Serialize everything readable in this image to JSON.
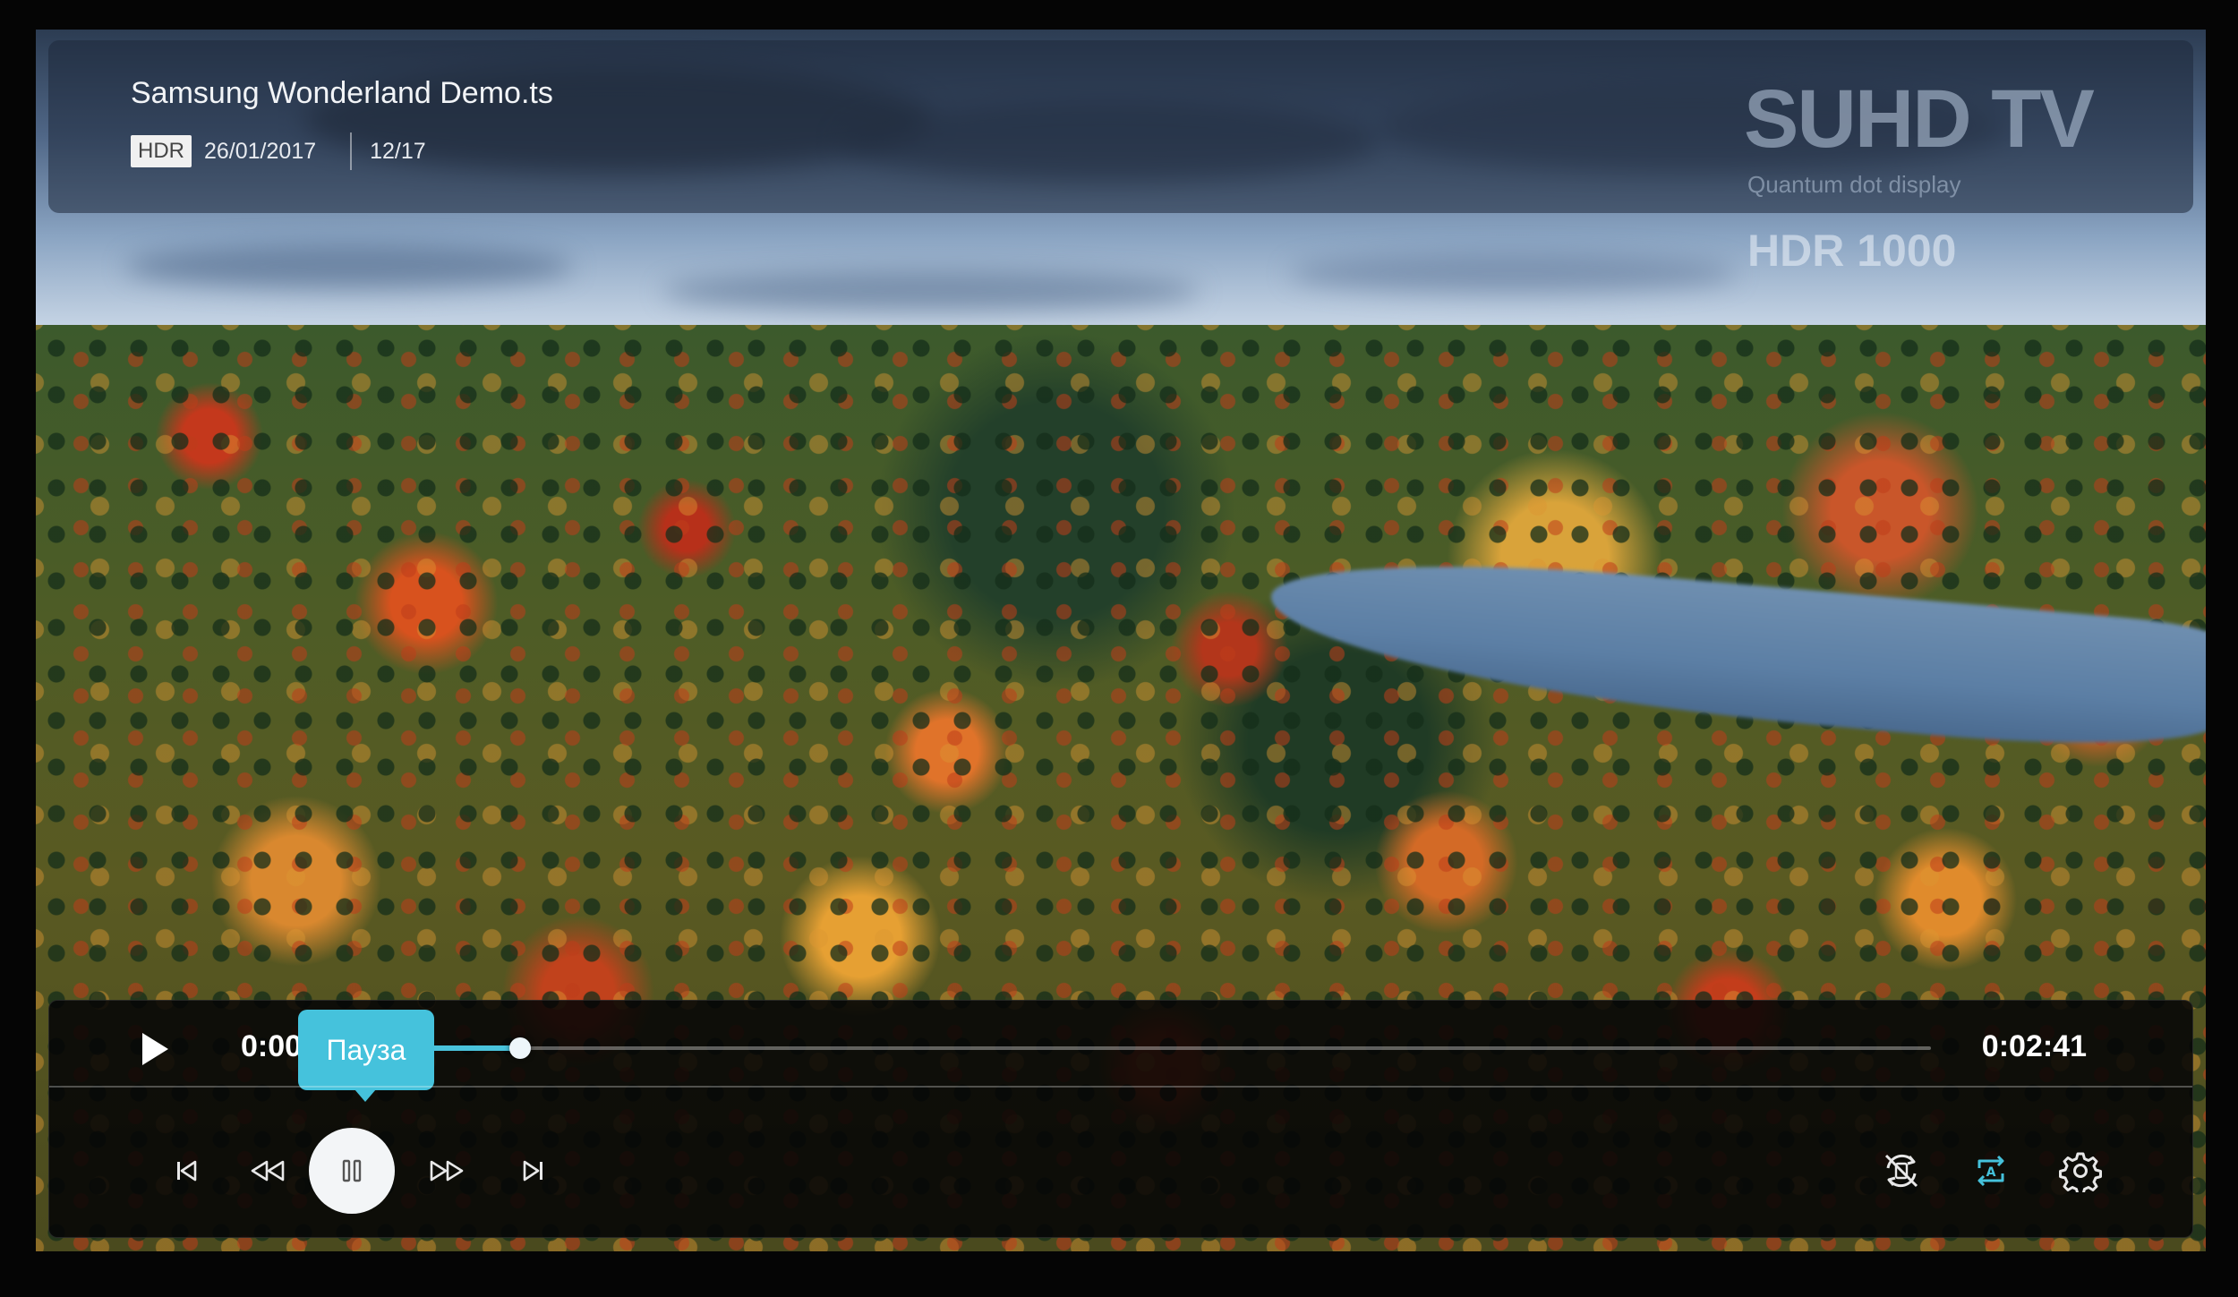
{
  "media": {
    "file_title": "Samsung Wonderland Demo.ts",
    "hdr_badge": "HDR",
    "date": "26/01/2017",
    "index": "12/17"
  },
  "brand": {
    "title": "SUHD TV",
    "subtitle": "Quantum dot display",
    "hdr": "HDR 1000"
  },
  "playback": {
    "current_time": "0:00:12",
    "total_time": "0:02:41",
    "progress_fraction": 0.074,
    "tooltip": "Пауза"
  },
  "controls": {
    "left": [
      {
        "name": "skip-previous-icon"
      },
      {
        "name": "rewind-icon"
      },
      {
        "name": "pause-icon"
      },
      {
        "name": "fast-forward-icon"
      },
      {
        "name": "skip-next-icon"
      }
    ],
    "right": [
      {
        "name": "rotate-off-icon"
      },
      {
        "name": "auto-repeat-icon",
        "active": true
      },
      {
        "name": "gear-icon"
      }
    ],
    "accent_color": "#45c2dc"
  }
}
